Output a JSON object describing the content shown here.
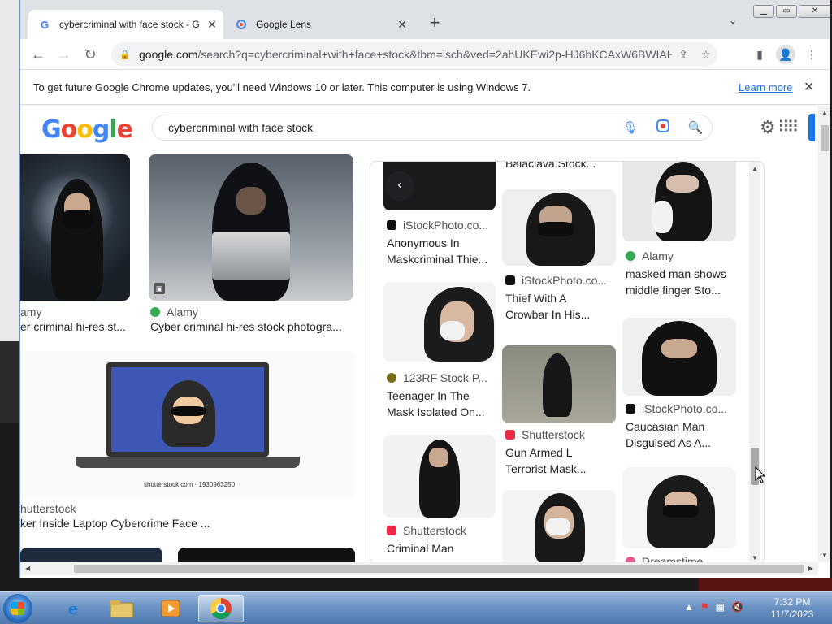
{
  "browser": {
    "tabs": [
      {
        "title": "cybercriminal with face stock - G",
        "active": true
      },
      {
        "title": "Google Lens",
        "active": false
      }
    ],
    "url_host": "google.com",
    "url_rest": "/search?q=cybercriminal+with+face+stock&tbm=isch&ved=2ahUKEwi2p-HJ6bKCAxW6BWIAHb...",
    "infobar_message": "To get future Google Chrome updates, you'll need Windows 10 or later. This computer is using Windows 7.",
    "infobar_link": "Learn more"
  },
  "google": {
    "logo": [
      "G",
      "o",
      "o",
      "g",
      "l",
      "e"
    ],
    "query": "cybercriminal with face stock"
  },
  "left_results": [
    {
      "source": "amy",
      "caption": "er criminal hi-res st..."
    },
    {
      "source": "Alamy",
      "caption": "Cyber criminal hi-res stock photogra..."
    },
    {
      "source": "hutterstock",
      "caption": "ker Inside Laptop Cybercrime Face ..."
    }
  ],
  "watermarks": {
    "shutterstock_id": "shutterstock.com · 1930963250"
  },
  "panel": {
    "col1": [
      {
        "source": "iStockPhoto.co...",
        "caption1": "Anonymous In",
        "caption2": "Maskcriminal Thie..."
      },
      {
        "source": "123RF Stock P...",
        "caption1": "Teenager In The",
        "caption2": "Mask Isolated On..."
      },
      {
        "source": "Shutterstock",
        "caption1": "Criminal Man",
        "caption2": ""
      }
    ],
    "col2": [
      {
        "caption_top": "Balaclava Stock..."
      },
      {
        "source": "iStockPhoto.co...",
        "caption1": "Thief With A",
        "caption2": "Crowbar In His..."
      },
      {
        "source": "Shutterstock",
        "caption1": "Gun Armed L",
        "caption2": "Terrorist Mask..."
      }
    ],
    "col3": [
      {
        "source": "Alamy",
        "caption1": "masked man shows",
        "caption2": "middle finger Sto..."
      },
      {
        "source": "iStockPhoto.co...",
        "caption1": "Caucasian Man",
        "caption2": "Disguised As A..."
      },
      {
        "source": "Dreamstime",
        "caption1": "",
        "caption2": ""
      }
    ]
  },
  "taskbar": {
    "time": "7:32 PM",
    "date": "11/7/2023"
  },
  "colors": {
    "google_blue": "#4285f4",
    "link_blue": "#1a73e8",
    "alamy_green": "#34a853",
    "shutterstock_red": "#ee2b47",
    "rf_olive": "#7a6a1c"
  }
}
